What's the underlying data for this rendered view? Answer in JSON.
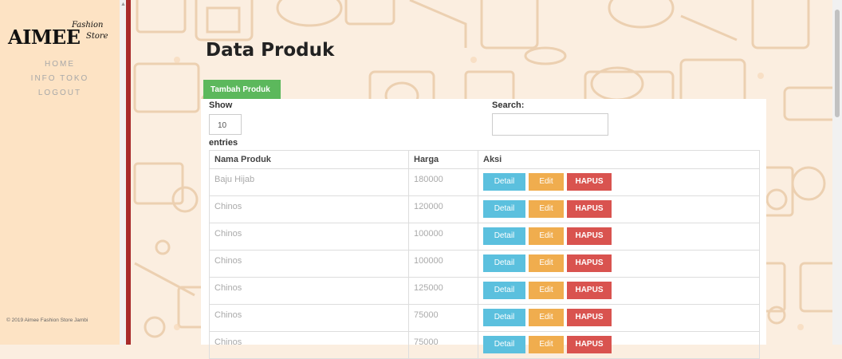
{
  "sidebar": {
    "logo": {
      "main": "AIMEE",
      "sub1": "Fashion",
      "sub2": "Store"
    },
    "nav": [
      {
        "label": "HOME"
      },
      {
        "label": "INFO TOKO"
      },
      {
        "label": "LOGOUT"
      }
    ],
    "footer": "© 2019 Aimee Fashion Store Jambi"
  },
  "main": {
    "title": "Data Produk",
    "add_button": "Tambah Produk",
    "show_label": "Show",
    "entries_value": "10",
    "entries_label": "entries",
    "search_label": "Search:",
    "search_value": "",
    "table": {
      "headers": [
        "Nama Produk",
        "Harga",
        "Aksi"
      ],
      "rows": [
        {
          "nama": "Baju Hijab",
          "harga": "180000"
        },
        {
          "nama": "Chinos",
          "harga": "120000"
        },
        {
          "nama": "Chinos",
          "harga": "100000"
        },
        {
          "nama": "Chinos",
          "harga": "100000"
        },
        {
          "nama": "Chinos",
          "harga": "125000"
        },
        {
          "nama": "Chinos",
          "harga": "75000"
        },
        {
          "nama": "Chinos",
          "harga": "75000"
        }
      ],
      "actions": {
        "detail": "Detail",
        "edit": "Edit",
        "hapus": "HAPUS"
      }
    }
  },
  "colors": {
    "sidebar_bg": "#fde3c4",
    "sidebar_border": "#a82b2b",
    "add_button": "#5cb85c",
    "detail_button": "#5bc0de",
    "edit_button": "#f0ad4e",
    "hapus_button": "#d9534f"
  }
}
